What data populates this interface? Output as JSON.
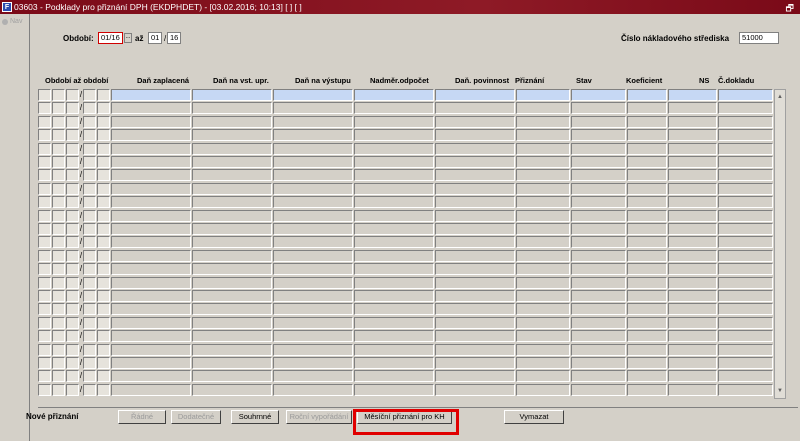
{
  "window": {
    "app_icon": "F",
    "title": "03603 - Podklady pro přiznání DPH (EKDPHDET) - [03.02.2016; 10:13] [ ] [ ]",
    "restore_glyph": "🗗"
  },
  "nav": {
    "label": "Nav"
  },
  "filters": {
    "obdobi_label": "Období:",
    "obdobi_from": "01/16",
    "lov_glyph": "...",
    "az_label": "až",
    "obdobi_to_month": "01",
    "obdobi_to_sep": "/",
    "obdobi_to_year": "16",
    "stredisko_label": "Číslo nákladového střediska",
    "stredisko_value": "51000"
  },
  "table": {
    "headers": [
      "Období až období",
      "Daň zaplacená",
      "Daň na vst. upr.",
      "Daň na výstupu",
      "Nadměr.odpočet",
      "Daň. povinnost",
      "Přiznání",
      "Stav",
      "Koeficient",
      "NS",
      "Č.dokladu"
    ],
    "slash": "/",
    "row_count": 23,
    "active_row": 0
  },
  "scroll": {
    "up": "▲",
    "down": "▼"
  },
  "footer": {
    "nove_label": "Nové přiznání",
    "buttons": [
      {
        "id": "radne",
        "label": "Řádné",
        "enabled": false
      },
      {
        "id": "dodatecne",
        "label": "Dodatečné",
        "enabled": false
      },
      {
        "id": "souhrnne",
        "label": "Souhrnné",
        "enabled": true
      },
      {
        "id": "rocni",
        "label": "Roční vypořádání",
        "enabled": false
      },
      {
        "id": "mesicni",
        "label": "Měsíční přiznání pro KH",
        "enabled": true
      },
      {
        "id": "vymazat",
        "label": "Vymazat",
        "enabled": true
      }
    ],
    "highlight_color": "#e00000"
  }
}
